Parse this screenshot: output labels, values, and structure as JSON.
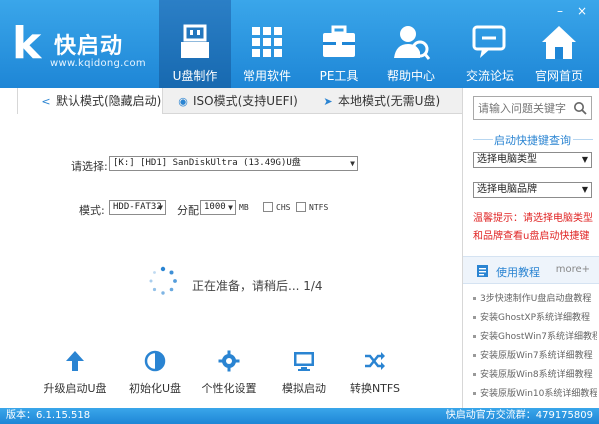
{
  "app": {
    "name": "快启动",
    "url": "www.kqidong.com",
    "logo_letter": "k"
  },
  "nav": [
    {
      "label": "U盘制作",
      "icon": "usb-drive-icon",
      "active": true
    },
    {
      "label": "常用软件",
      "icon": "apps-grid-icon",
      "active": false
    },
    {
      "label": "PE工具",
      "icon": "toolbox-icon",
      "active": false
    },
    {
      "label": "帮助中心",
      "icon": "help-person-icon",
      "active": false
    },
    {
      "label": "交流论坛",
      "icon": "forum-chat-icon",
      "active": false
    },
    {
      "label": "官网首页",
      "icon": "home-icon",
      "active": false
    }
  ],
  "tabs": [
    {
      "label": "默认模式(隐藏启动)",
      "icon": "share-icon",
      "active": true
    },
    {
      "label": "ISO模式(支持UEFI)",
      "icon": "disc-icon",
      "active": false
    },
    {
      "label": "本地模式(无需U盘)",
      "icon": "send-icon",
      "active": false
    }
  ],
  "form": {
    "select_label": "请选择:",
    "device_value": "[K:] [HD1] SanDiskUltra (13.49G)U盘",
    "mode_label": "模式:",
    "mode_value": "HDD-FAT32",
    "alloc_label": "分配",
    "alloc_value": "1000",
    "alloc_unit": "MB",
    "chs_label": "CHS",
    "ntfs_label": "NTFS"
  },
  "status_text": "正在准备，请稍后... 1/4",
  "tools": [
    {
      "label": "升级启动U盘",
      "icon": "upgrade-arrow-icon"
    },
    {
      "label": "初始化U盘",
      "icon": "initialize-icon"
    },
    {
      "label": "个性化设置",
      "icon": "settings-gear-icon"
    },
    {
      "label": "模拟启动",
      "icon": "monitor-icon"
    },
    {
      "label": "转换NTFS",
      "icon": "shuffle-icon"
    }
  ],
  "sidebar": {
    "search_placeholder": "请输入问题关键字",
    "section_title": "启动快捷键查询",
    "type_select": "选择电脑类型",
    "brand_select": "选择电脑品牌",
    "tip": "温馨提示：请选择电脑类型和品牌查看u盘启动快捷键",
    "tutorial_title": "使用教程",
    "more_label": "more+",
    "tutorials": [
      "3步快速制作U盘启动盘教程",
      "安装GhostXP系统详细教程",
      "安装GhostWin7系统详细教程",
      "安装原版Win7系统详细教程",
      "安装原版Win8系统详细教程",
      "安装原版Win10系统详细教程"
    ]
  },
  "statusbar": {
    "version": "版本：6.1.15.518",
    "qq_group": "快启动官方交流群：479175809"
  },
  "colors": {
    "header_blue": "#1e86d6",
    "accent_blue": "#2a84d2",
    "tip_red": "#e02424"
  }
}
